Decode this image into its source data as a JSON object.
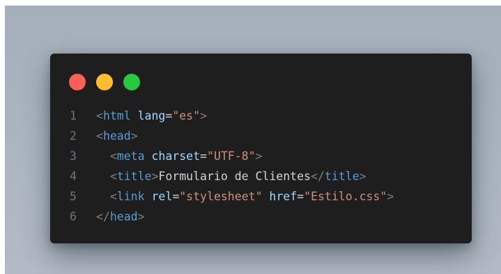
{
  "window_controls": [
    {
      "name": "close",
      "color": "#ff5f56"
    },
    {
      "name": "minimize",
      "color": "#ffbd2e"
    },
    {
      "name": "maximize",
      "color": "#27c93f"
    }
  ],
  "code": {
    "lines": [
      {
        "number": "1",
        "indent": "",
        "tokens": [
          {
            "type": "punct",
            "text": "<"
          },
          {
            "type": "tag",
            "text": "html"
          },
          {
            "type": "txt",
            "text": " "
          },
          {
            "type": "attr",
            "text": "lang"
          },
          {
            "type": "eq",
            "text": "="
          },
          {
            "type": "str",
            "text": "\"es\""
          },
          {
            "type": "punct",
            "text": ">"
          }
        ]
      },
      {
        "number": "2",
        "indent": "",
        "tokens": [
          {
            "type": "punct",
            "text": "<"
          },
          {
            "type": "tag",
            "text": "head"
          },
          {
            "type": "punct",
            "text": ">"
          }
        ]
      },
      {
        "number": "3",
        "indent": "  ",
        "tokens": [
          {
            "type": "punct",
            "text": "<"
          },
          {
            "type": "tag",
            "text": "meta"
          },
          {
            "type": "txt",
            "text": " "
          },
          {
            "type": "attr",
            "text": "charset"
          },
          {
            "type": "eq",
            "text": "="
          },
          {
            "type": "str",
            "text": "\"UTF-8\""
          },
          {
            "type": "punct",
            "text": ">"
          }
        ]
      },
      {
        "number": "4",
        "indent": "  ",
        "tokens": [
          {
            "type": "punct",
            "text": "<"
          },
          {
            "type": "tag",
            "text": "title"
          },
          {
            "type": "punct",
            "text": ">"
          },
          {
            "type": "txt",
            "text": "Formulario de Clientes"
          },
          {
            "type": "punct",
            "text": "</"
          },
          {
            "type": "tag",
            "text": "title"
          },
          {
            "type": "punct",
            "text": ">"
          }
        ]
      },
      {
        "number": "5",
        "indent": "  ",
        "tokens": [
          {
            "type": "punct",
            "text": "<"
          },
          {
            "type": "tag",
            "text": "link"
          },
          {
            "type": "txt",
            "text": " "
          },
          {
            "type": "attr",
            "text": "rel"
          },
          {
            "type": "eq",
            "text": "="
          },
          {
            "type": "str",
            "text": "\"stylesheet\""
          },
          {
            "type": "txt",
            "text": " "
          },
          {
            "type": "attr",
            "text": "href"
          },
          {
            "type": "eq",
            "text": "="
          },
          {
            "type": "str",
            "text": "\"Estilo.css\""
          },
          {
            "type": "punct",
            "text": ">"
          }
        ]
      },
      {
        "number": "6",
        "indent": "",
        "tokens": [
          {
            "type": "punct",
            "text": "</"
          },
          {
            "type": "tag",
            "text": "head"
          },
          {
            "type": "punct",
            "text": ">"
          }
        ]
      }
    ]
  }
}
